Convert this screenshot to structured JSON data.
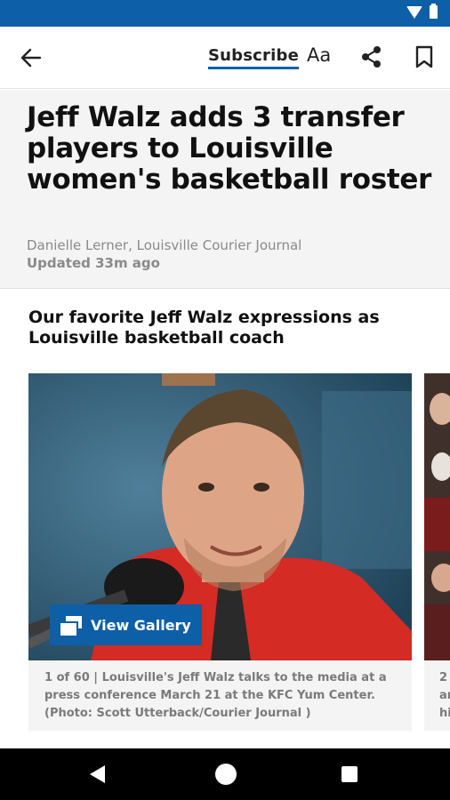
{
  "app_bar": {
    "subscribe_label": "Subscribe",
    "font_size_label": "Aa",
    "back_icon": "arrow-left-icon",
    "share_icon": "share-icon",
    "bookmark_icon": "bookmark-icon"
  },
  "article": {
    "headline": "Jeff Walz adds 3 transfer players to Louisville women's basketball roster",
    "byline": "Danielle Lerner, Louisville Courier Journal",
    "updated": "Updated 33m ago"
  },
  "gallery": {
    "title": "Our favorite Jeff Walz expressions as Louisville basketball coach",
    "view_gallery_label": "View Gallery",
    "caption": "1 of 60 | Louisville's Jeff Walz talks to the media at a press conference March 21 at the KFC Yum Center. (Photo: Scott Utterback/Courier Journal )",
    "next_caption_fragment": "2\nar\nhi"
  },
  "colors": {
    "accent": "#0d5fa8",
    "status_bar": "#0d5fa8",
    "headline_bg": "#f4f4f4"
  }
}
